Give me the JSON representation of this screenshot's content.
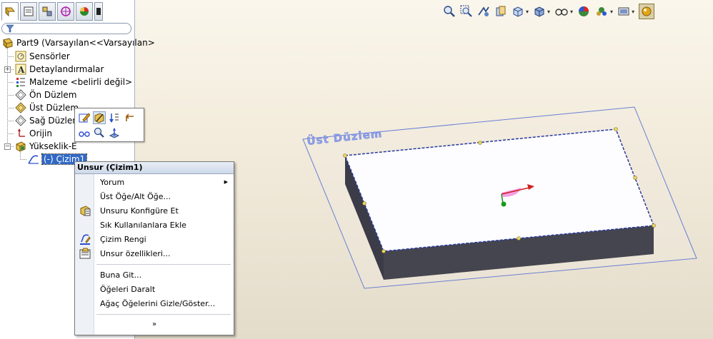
{
  "tree": {
    "part": "Part9  (Varsayılan<<Varsayılan>",
    "items": [
      {
        "label": "Sensörler",
        "icon": "sensor-icon"
      },
      {
        "label": "Detaylandırmalar",
        "icon": "annotations-icon"
      },
      {
        "label": "Malzeme <belirli değil>",
        "icon": "material-icon"
      },
      {
        "label": "Ön Düzlem",
        "icon": "plane-icon"
      },
      {
        "label": "Üst Düzlem",
        "icon": "plane-icon"
      },
      {
        "label": "Sağ Düzlem",
        "icon": "plane-icon"
      },
      {
        "label": "Orijin",
        "icon": "origin-icon"
      },
      {
        "label": "Yükseklik-E",
        "icon": "extrude-icon"
      }
    ],
    "sketch": "(-) Çizim1"
  },
  "viewport": {
    "plane_label": "Üst Düzlem"
  },
  "context_menu": {
    "title": "Unsur (Çizim1)",
    "items": [
      {
        "label": "Yorum",
        "submenu": true
      },
      {
        "label": "Üst Öğe/Alt Öğe..."
      },
      {
        "label": "Unsuru Konfigüre Et",
        "icon": "configure-feature-icon"
      },
      {
        "label": "Sık Kullanılanlara Ekle"
      },
      {
        "label": "Çizim Rengi",
        "icon": "sketch-color-icon"
      },
      {
        "label": "Unsur özellikleri...",
        "icon": "feature-properties-icon"
      },
      {
        "label": "Buna Git..."
      },
      {
        "label": "Öğeleri Daralt"
      },
      {
        "label": "Ağaç Öğelerini Gizle/Göster..."
      }
    ],
    "more": "»"
  },
  "colors": {
    "selection": "#3169c6",
    "plane_blue": "#6a7fd4",
    "box_top": "#fdfdff",
    "box_side": "#40404c"
  }
}
